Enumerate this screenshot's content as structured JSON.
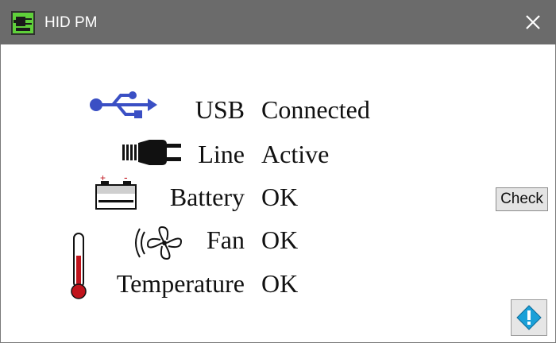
{
  "window": {
    "title": "HID PM"
  },
  "rows": [
    {
      "label": "USB",
      "value": "Connected",
      "icon": "usb-icon"
    },
    {
      "label": "Line",
      "value": "Active",
      "icon": "power-plug-icon"
    },
    {
      "label": "Battery",
      "value": "OK",
      "icon": "battery-icon"
    },
    {
      "label": "Fan",
      "value": "OK",
      "icon": "fan-icon"
    },
    {
      "label": "Temperature",
      "value": "OK",
      "icon": "thermometer-icon"
    }
  ],
  "buttons": {
    "check_label": "Check",
    "info_icon": "info-icon"
  },
  "colors": {
    "titlebar": "#6b6b6b",
    "usb": "#3a4fc4",
    "thermometer": "#c0141c",
    "info": "#1aa0d8"
  }
}
